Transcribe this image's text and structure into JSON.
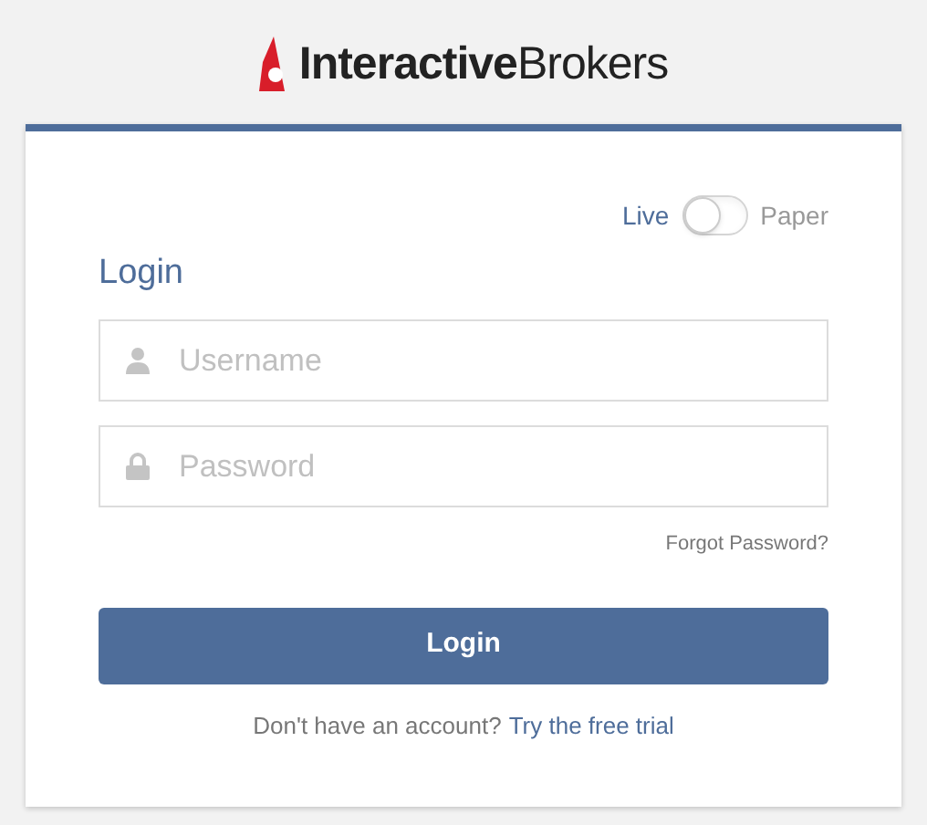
{
  "logo": {
    "text": "**Interactive**Brokers"
  },
  "mode_toggle": {
    "left_label": "Live",
    "right_label": "Paper",
    "on": false
  },
  "form": {
    "title": "Login",
    "fields": [
      {
        "kind": "user",
        "placeholder": "Username"
      },
      {
        "kind": "lock",
        "placeholder": "Password"
      }
    ],
    "forgot_link": "Forgot Password?",
    "submit": "Login",
    "signup_text": "Don't have an account?",
    "signup_link": "Try the free trial"
  }
}
